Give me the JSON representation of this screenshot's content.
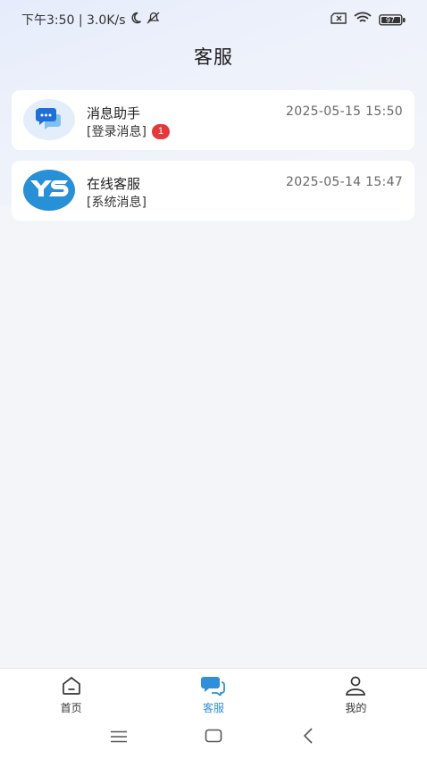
{
  "status_bar": {
    "left_text": "下午3:50 | 3.0K/s",
    "battery": "97"
  },
  "header": {
    "title": "客服"
  },
  "conversations": [
    {
      "name": "消息助手",
      "time": "2025-05-15 15:50",
      "preview": "[登录消息]",
      "badge": "1",
      "icon": "chat-bubble-icon"
    },
    {
      "name": "在线客服",
      "time": "2025-05-14 15:47",
      "preview": "[系统消息]",
      "icon": "ys-logo-icon"
    }
  ],
  "tabbar": {
    "items": [
      {
        "label": "首页",
        "icon": "home-icon"
      },
      {
        "label": "客服",
        "icon": "customer-service-icon",
        "active": true
      },
      {
        "label": "我的",
        "icon": "profile-icon"
      }
    ]
  },
  "colors": {
    "accent": "#2f8fd8",
    "badge": "#e5383b",
    "background": "#f3f5f9"
  }
}
